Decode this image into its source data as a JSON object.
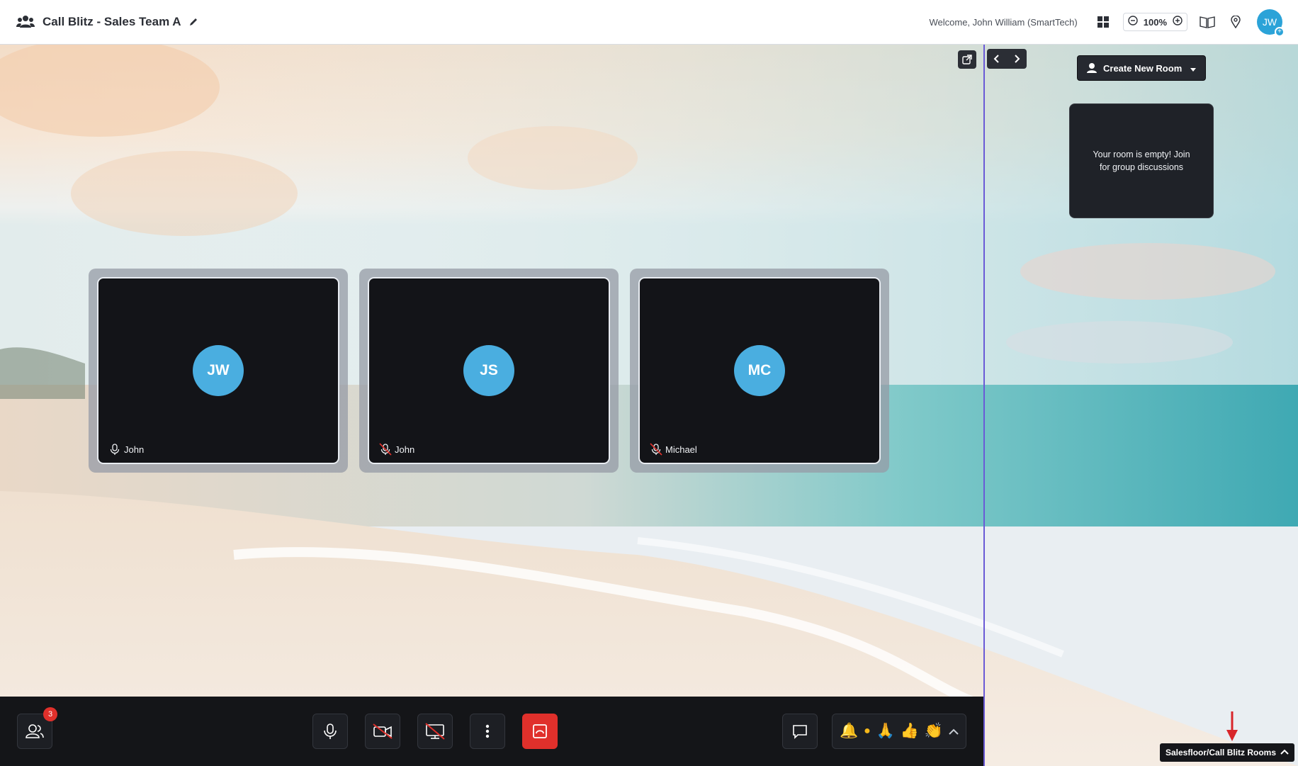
{
  "header": {
    "title": "Call Blitz - Sales Team A",
    "welcome": "Welcome, John William (SmartTech)",
    "zoom": "100%",
    "user_initials": "JW",
    "user_plus": "+"
  },
  "tiles": [
    {
      "initials": "JW",
      "name": "John",
      "muted": false
    },
    {
      "initials": "JS",
      "name": "John",
      "muted": true
    },
    {
      "initials": "MC",
      "name": "Michael",
      "muted": true
    }
  ],
  "rooms": {
    "create_label": "Create New Room",
    "empty_message": "Your room is empty! Join for group discussions"
  },
  "bottom": {
    "participants_count": "3",
    "reactions": [
      "🔔",
      "●",
      "🙏",
      "👍",
      "👏"
    ]
  },
  "location": {
    "label": "Salesfloor/Call Blitz Rooms"
  },
  "colors": {
    "accent": "#2ba3d8",
    "avatar": "#4aaee0",
    "danger": "#e0302b",
    "divider": "#6a5ad6"
  }
}
